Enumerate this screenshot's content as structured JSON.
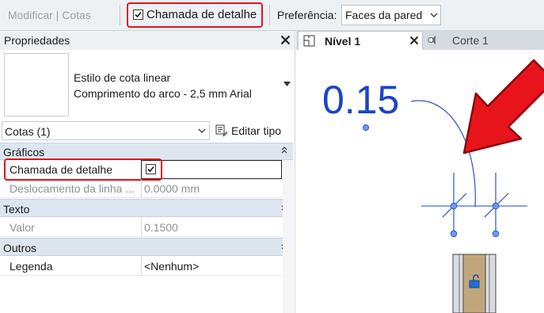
{
  "options_bar": {
    "context": "Modificar | Cotas",
    "detail_callout_label": "Chamada de detalhe",
    "detail_callout_checked": true,
    "preference_label": "Preferência:",
    "preference_value": "Faces da pared"
  },
  "properties": {
    "title": "Propriedades",
    "type_line1": "Estilo de cota linear",
    "type_line2": "Comprimento do arco - 2,5 mm Arial",
    "filter_value": "Cotas (1)",
    "edit_type_label": "Editar tipo",
    "sections": [
      {
        "name": "Gráficos",
        "rows": [
          {
            "label": "Chamada de detalhe",
            "value": "",
            "checked": true
          },
          {
            "label": "Deslocamento da linha ...",
            "value": "0.0000 mm"
          }
        ]
      },
      {
        "name": "Texto",
        "rows": [
          {
            "label": "Valor",
            "value": "0.1500"
          }
        ]
      },
      {
        "name": "Outros",
        "rows": [
          {
            "label": "Legenda",
            "value": "<Nenhum>"
          }
        ]
      }
    ]
  },
  "view": {
    "tab_active": "Nível 1",
    "tab_inactive": "Corte 1",
    "dimension_text": "0.15",
    "colors": {
      "dimension_blue": "#1a44c8",
      "arrow_red": "#e8141c",
      "wall_brown": "#c2a77c"
    }
  }
}
